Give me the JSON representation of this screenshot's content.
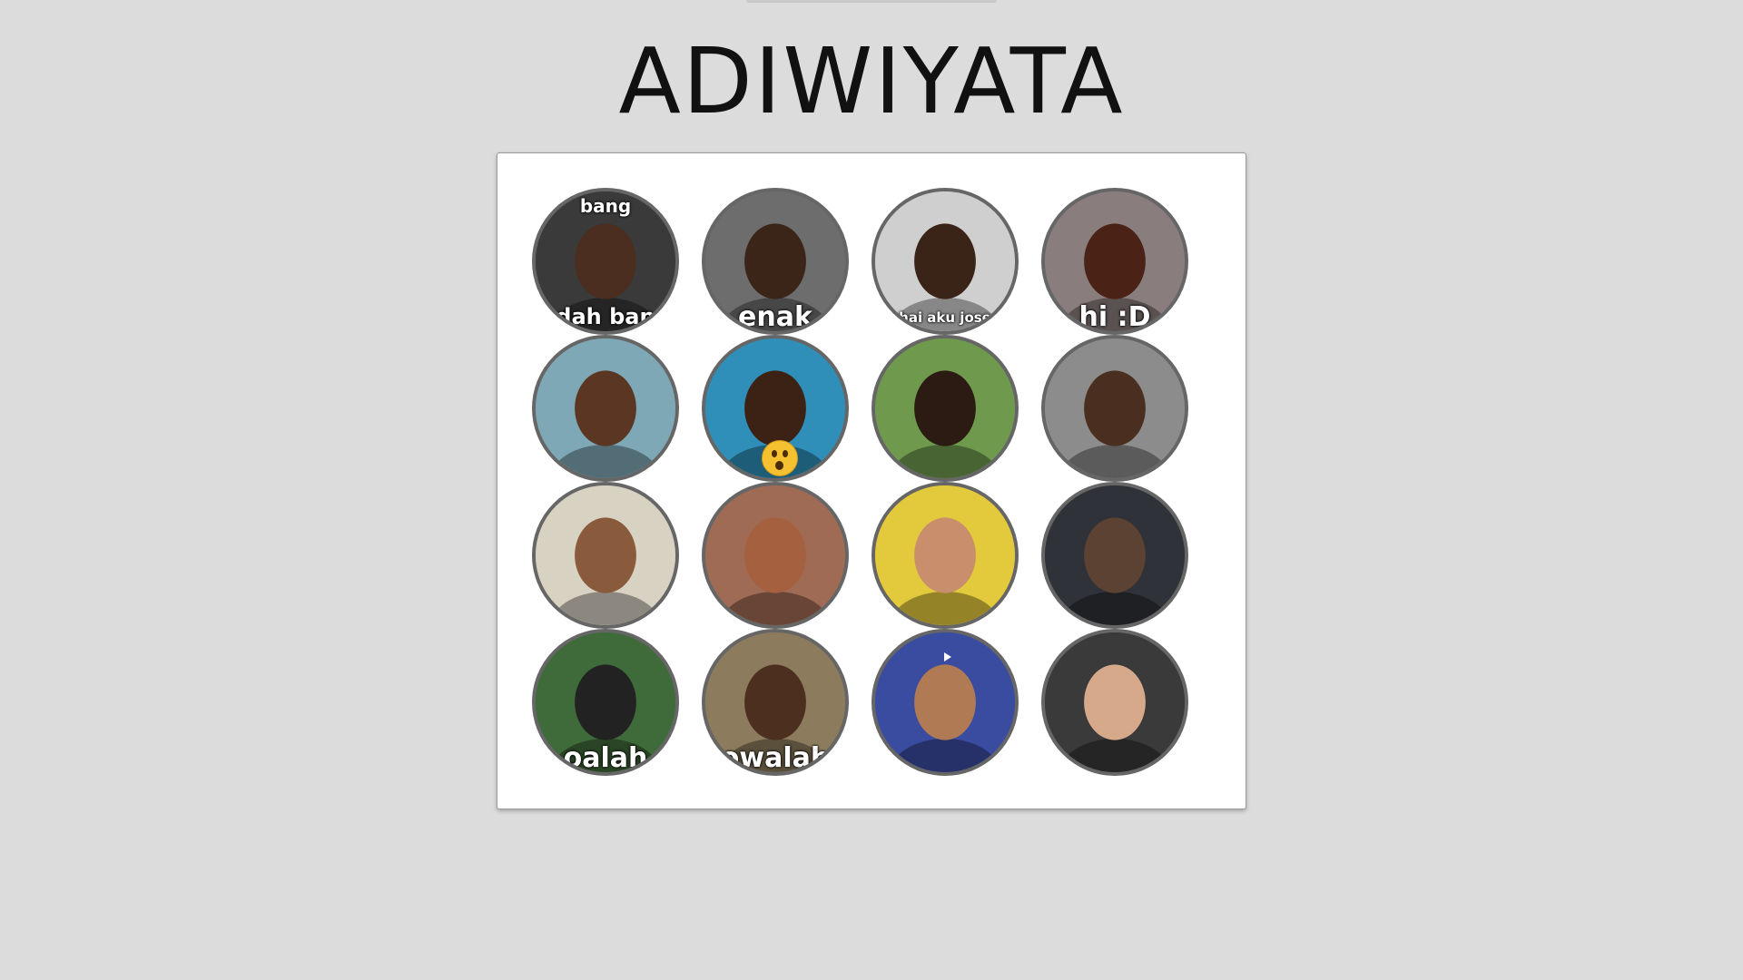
{
  "page": {
    "title": "ADIWIYATA"
  },
  "gallery": {
    "items": [
      {
        "name": "avatar-1",
        "caption_top": "bang",
        "caption_bottom": "udah bang",
        "bg": "#3a3a3a",
        "skin": "#4b2e1f"
      },
      {
        "name": "avatar-2",
        "caption_top": "",
        "caption_bottom": "enak",
        "bg": "#6d6d6d",
        "skin": "#3b2418"
      },
      {
        "name": "avatar-3",
        "caption_top": "",
        "caption_bottom": "hai aku jose",
        "bg": "#cfcfcf",
        "skin": "#3a2417"
      },
      {
        "name": "avatar-4",
        "caption_top": "",
        "caption_bottom": "hi :D",
        "bg": "#8a7d7d",
        "skin": "#4a2216"
      },
      {
        "name": "avatar-5",
        "caption_top": "",
        "caption_bottom": "",
        "bg": "#7ea8b5",
        "skin": "#5a3623"
      },
      {
        "name": "avatar-6",
        "caption_top": "",
        "caption_bottom": "",
        "bg": "#2f8fb8",
        "skin": "#3c2215",
        "emoji": "astonished-face-icon"
      },
      {
        "name": "avatar-7",
        "caption_top": "",
        "caption_bottom": "",
        "bg": "#6f9a4e",
        "skin": "#2b1b12"
      },
      {
        "name": "avatar-8",
        "caption_top": "",
        "caption_bottom": "",
        "bg": "#8c8c8c",
        "skin": "#4a2e20"
      },
      {
        "name": "avatar-9",
        "caption_top": "",
        "caption_bottom": "",
        "bg": "#d8d2c3",
        "skin": "#8a5a3d"
      },
      {
        "name": "avatar-10",
        "caption_top": "",
        "caption_bottom": "",
        "bg": "#a06b55",
        "skin": "#a5603f"
      },
      {
        "name": "avatar-11",
        "caption_top": "",
        "caption_bottom": "",
        "bg": "#e3c93c",
        "skin": "#c98f6c"
      },
      {
        "name": "avatar-12",
        "caption_top": "",
        "caption_bottom": "",
        "bg": "#2f3238",
        "skin": "#5b4232"
      },
      {
        "name": "avatar-13",
        "caption_top": "",
        "caption_bottom": "oalah",
        "bg": "#3f6b3a",
        "skin": "#222222"
      },
      {
        "name": "avatar-14",
        "caption_top": "",
        "caption_bottom": "owalah",
        "bg": "#8c7c5d",
        "skin": "#4c2f1f"
      },
      {
        "name": "avatar-15",
        "caption_top": "",
        "caption_bottom": "",
        "bg": "#3a4ca0",
        "skin": "#b07a55",
        "play": "play-icon"
      },
      {
        "name": "avatar-16",
        "caption_top": "",
        "caption_bottom": "",
        "bg": "#3a3a3a",
        "skin": "#d6a98a"
      }
    ]
  }
}
